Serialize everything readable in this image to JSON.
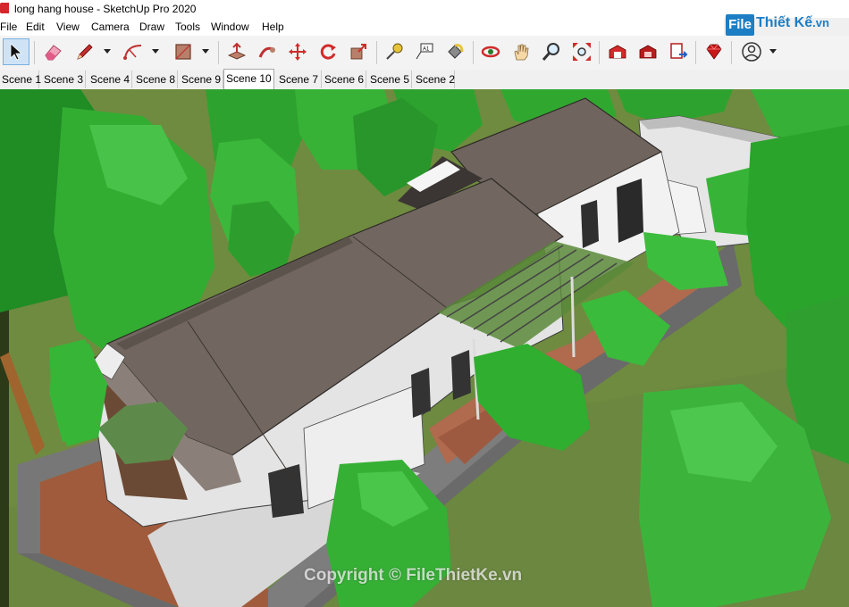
{
  "window": {
    "title": "long hang house - SketchUp Pro 2020"
  },
  "menu": [
    "File",
    "Edit",
    "View",
    "Camera",
    "Draw",
    "Tools",
    "Window",
    "Help"
  ],
  "logo": {
    "box": "File",
    "main": "Thiết Kế",
    "tld": ".vn"
  },
  "toolbar": {
    "tools": [
      {
        "icon": "select-arrow-icon",
        "active": true
      },
      {
        "icon": "eraser-icon"
      },
      {
        "icon": "pencil-line-icon",
        "dropdown": true
      },
      {
        "icon": "arc-icon",
        "dropdown": true
      },
      {
        "icon": "rectangle-icon",
        "dropdown": true
      },
      {
        "icon": "push-pull-icon"
      },
      {
        "icon": "follow-me-icon"
      },
      {
        "icon": "move-icon"
      },
      {
        "icon": "rotate-icon"
      },
      {
        "icon": "scale-icon"
      },
      {
        "icon": "tape-measure-icon"
      },
      {
        "icon": "text-label-icon"
      },
      {
        "icon": "paint-bucket-icon"
      },
      {
        "icon": "orbit-icon"
      },
      {
        "icon": "pan-hand-icon"
      },
      {
        "icon": "zoom-icon"
      },
      {
        "icon": "zoom-extents-icon"
      },
      {
        "icon": "warehouse-icon"
      },
      {
        "icon": "extension-warehouse-icon"
      },
      {
        "icon": "send-to-layout-icon"
      },
      {
        "icon": "ruby-console-icon"
      },
      {
        "icon": "account-user-icon",
        "dropdown": true
      }
    ]
  },
  "scenes": {
    "tabs": [
      "Scene 1",
      "Scene 3",
      "Scene 4",
      "Scene 8",
      "Scene 9",
      "Scene 10",
      "Scene 7",
      "Scene 6",
      "Scene 5",
      "Scene 2"
    ],
    "active": "Scene 10"
  },
  "viewport": {
    "watermark": "Copyright © FileThietKe.vn"
  },
  "colors": {
    "grass": "#6f8b3f",
    "roof": "#6f655e",
    "tree": "#2ea22e",
    "path": "#b06a4e"
  }
}
